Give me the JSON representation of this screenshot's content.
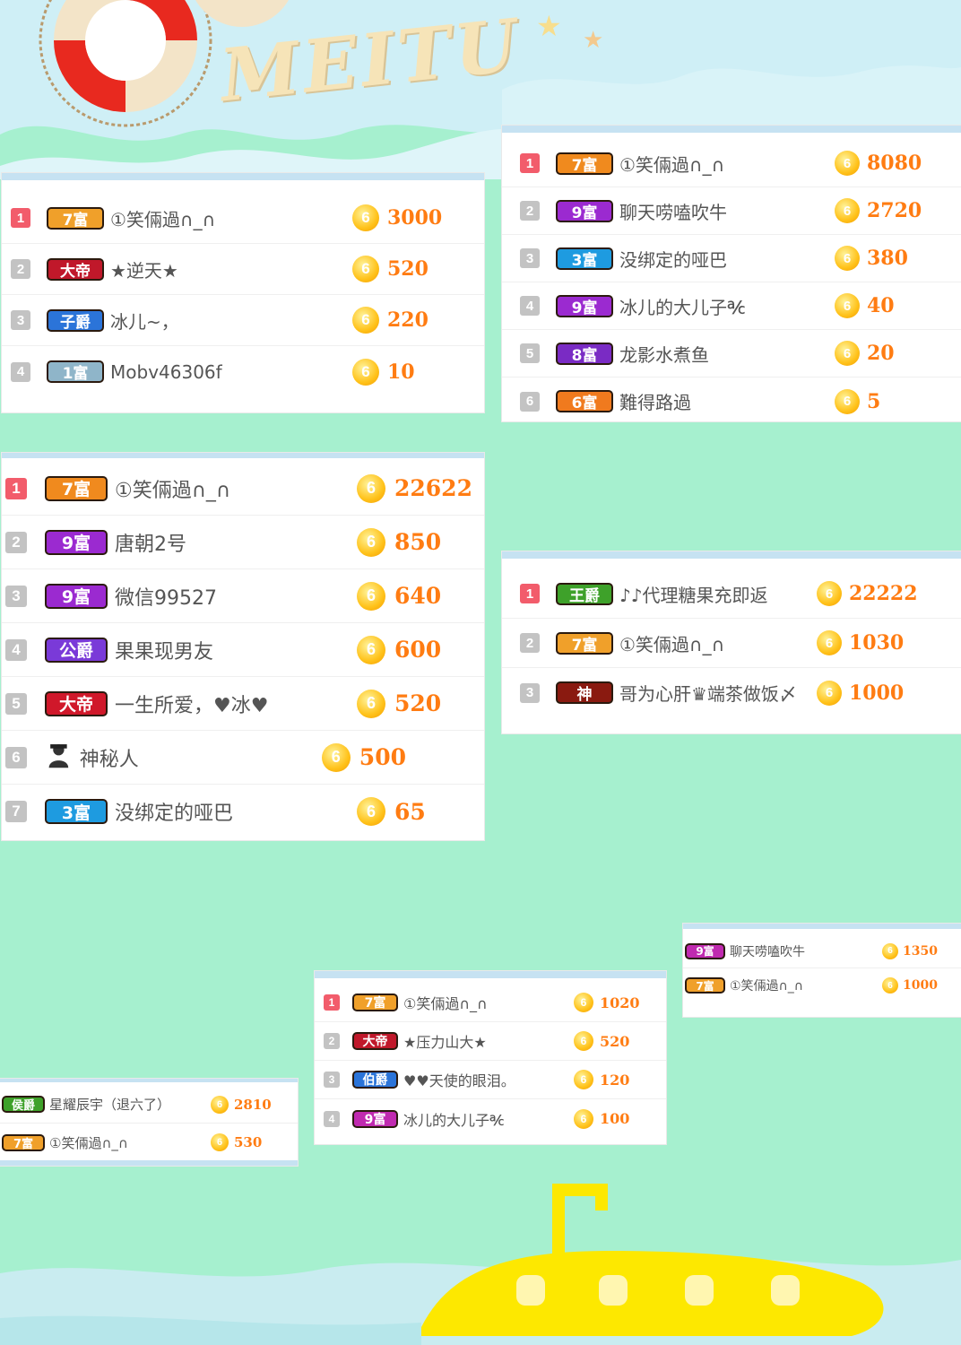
{
  "logo": {
    "text": "MEITU"
  },
  "colors": {
    "background": "#a6f0cf",
    "rank_first": "#f25c6b",
    "rank_other": "#c3c3c3",
    "amount": "#ff7c12",
    "coin": "#ffc21a",
    "submarine": "#fde800"
  },
  "coin_icon": {
    "name": "gold-coin-icon",
    "glyph": "6"
  },
  "panels": [
    {
      "id": "p1",
      "rows": [
        {
          "rank": "1",
          "badge": "7富",
          "badge_color": "#f0a02a",
          "name": "①笑倆過∩_∩",
          "amount": "3000"
        },
        {
          "rank": "2",
          "badge": "大帝",
          "badge_color": "#c0182a",
          "name": "★逆天★",
          "amount": "520"
        },
        {
          "rank": "3",
          "badge": "子爵",
          "badge_color": "#2b74d9",
          "name": "冰儿~，",
          "amount": "220"
        },
        {
          "rank": "4",
          "badge": "1富",
          "badge_color": "#8fb5c9",
          "name": "Mobv46306f",
          "amount": "10"
        }
      ]
    },
    {
      "id": "p2",
      "rows": [
        {
          "rank": "1",
          "badge": "7富",
          "badge_color": "#f08a1e",
          "name": "①笑倆過∩_∩",
          "amount": "8080"
        },
        {
          "rank": "2",
          "badge": "9富",
          "badge_color": "#9b2ad0",
          "name": "聊天唠嗑吹牛",
          "amount": "2720"
        },
        {
          "rank": "3",
          "badge": "3富",
          "badge_color": "#1e9be0",
          "name": "没绑定的哑巴",
          "amount": "380"
        },
        {
          "rank": "4",
          "badge": "9富",
          "badge_color": "#9b2ad0",
          "name": "冰儿的大儿子℀",
          "amount": "40"
        },
        {
          "rank": "5",
          "badge": "8富",
          "badge_color": "#7a2bc4",
          "name": "龙影水煮鱼",
          "amount": "20"
        },
        {
          "rank": "6",
          "badge": "6富",
          "badge_color": "#f07a1e",
          "name": "難得路過",
          "amount": "5"
        }
      ]
    },
    {
      "id": "p3",
      "rows": [
        {
          "rank": "1",
          "badge": "7富",
          "badge_color": "#f08a1e",
          "name": "①笑倆過∩_∩",
          "amount": "22622"
        },
        {
          "rank": "2",
          "badge": "9富",
          "badge_color": "#9b2ad0",
          "name": "唐朝2号",
          "amount": "850"
        },
        {
          "rank": "3",
          "badge": "9富",
          "badge_color": "#9b2ad0",
          "name": "微信99527",
          "amount": "640"
        },
        {
          "rank": "4",
          "badge": "公爵",
          "badge_color": "#7a3ad8",
          "name": "果果现男友",
          "amount": "600"
        },
        {
          "rank": "5",
          "badge": "大帝",
          "badge_color": "#d0182a",
          "name": "一生所爱，♥冰♥",
          "amount": "520"
        },
        {
          "rank": "6",
          "badge": "",
          "badge_color": "",
          "icon": "mystery-person-icon",
          "name": "神秘人",
          "amount": "500"
        },
        {
          "rank": "7",
          "badge": "3富",
          "badge_color": "#1e9be0",
          "name": "没绑定的哑巴",
          "amount": "65"
        }
      ]
    },
    {
      "id": "p4",
      "rows": [
        {
          "rank": "1",
          "badge": "王爵",
          "badge_color": "#3ea12a",
          "name": "♪♪代理糖果充即返",
          "amount": "22222"
        },
        {
          "rank": "2",
          "badge": "7富",
          "badge_color": "#f0a02a",
          "name": "①笑倆過∩_∩",
          "amount": "1030"
        },
        {
          "rank": "3",
          "badge": "神",
          "badge_color": "#8a1a10",
          "name": "哥为心肝♛端茶做饭〆",
          "amount": "1000"
        }
      ]
    },
    {
      "id": "p5",
      "rows": [
        {
          "rank": "1",
          "badge": "7富",
          "badge_color": "#f0a02a",
          "name": "①笑倆過∩_∩",
          "amount": "1020"
        },
        {
          "rank": "2",
          "badge": "大帝",
          "badge_color": "#c0182a",
          "name": "★压力山大★",
          "amount": "520"
        },
        {
          "rank": "3",
          "badge": "伯爵",
          "badge_color": "#2b74d9",
          "name": "♥♥天使的眼泪。",
          "amount": "120"
        },
        {
          "rank": "4",
          "badge": "9富",
          "badge_color": "#c02ab0",
          "name": "冰儿的大儿子℀",
          "amount": "100"
        }
      ]
    },
    {
      "id": "p6",
      "rows": [
        {
          "rank": "",
          "badge": "侯爵",
          "badge_color": "#3ea12a",
          "name": "星耀辰宇（退六了）",
          "amount": "2810"
        },
        {
          "rank": "",
          "badge": "7富",
          "badge_color": "#f0a02a",
          "name": "①笑倆過∩_∩",
          "amount": "530"
        }
      ]
    },
    {
      "id": "p7",
      "rows": [
        {
          "rank": "",
          "badge": "9富",
          "badge_color": "#c02ab0",
          "name": "聊天唠嗑吹牛",
          "amount": "1350"
        },
        {
          "rank": "",
          "badge": "7富",
          "badge_color": "#f0a02a",
          "name": "①笑倆過∩_∩",
          "amount": "1000"
        }
      ]
    }
  ]
}
